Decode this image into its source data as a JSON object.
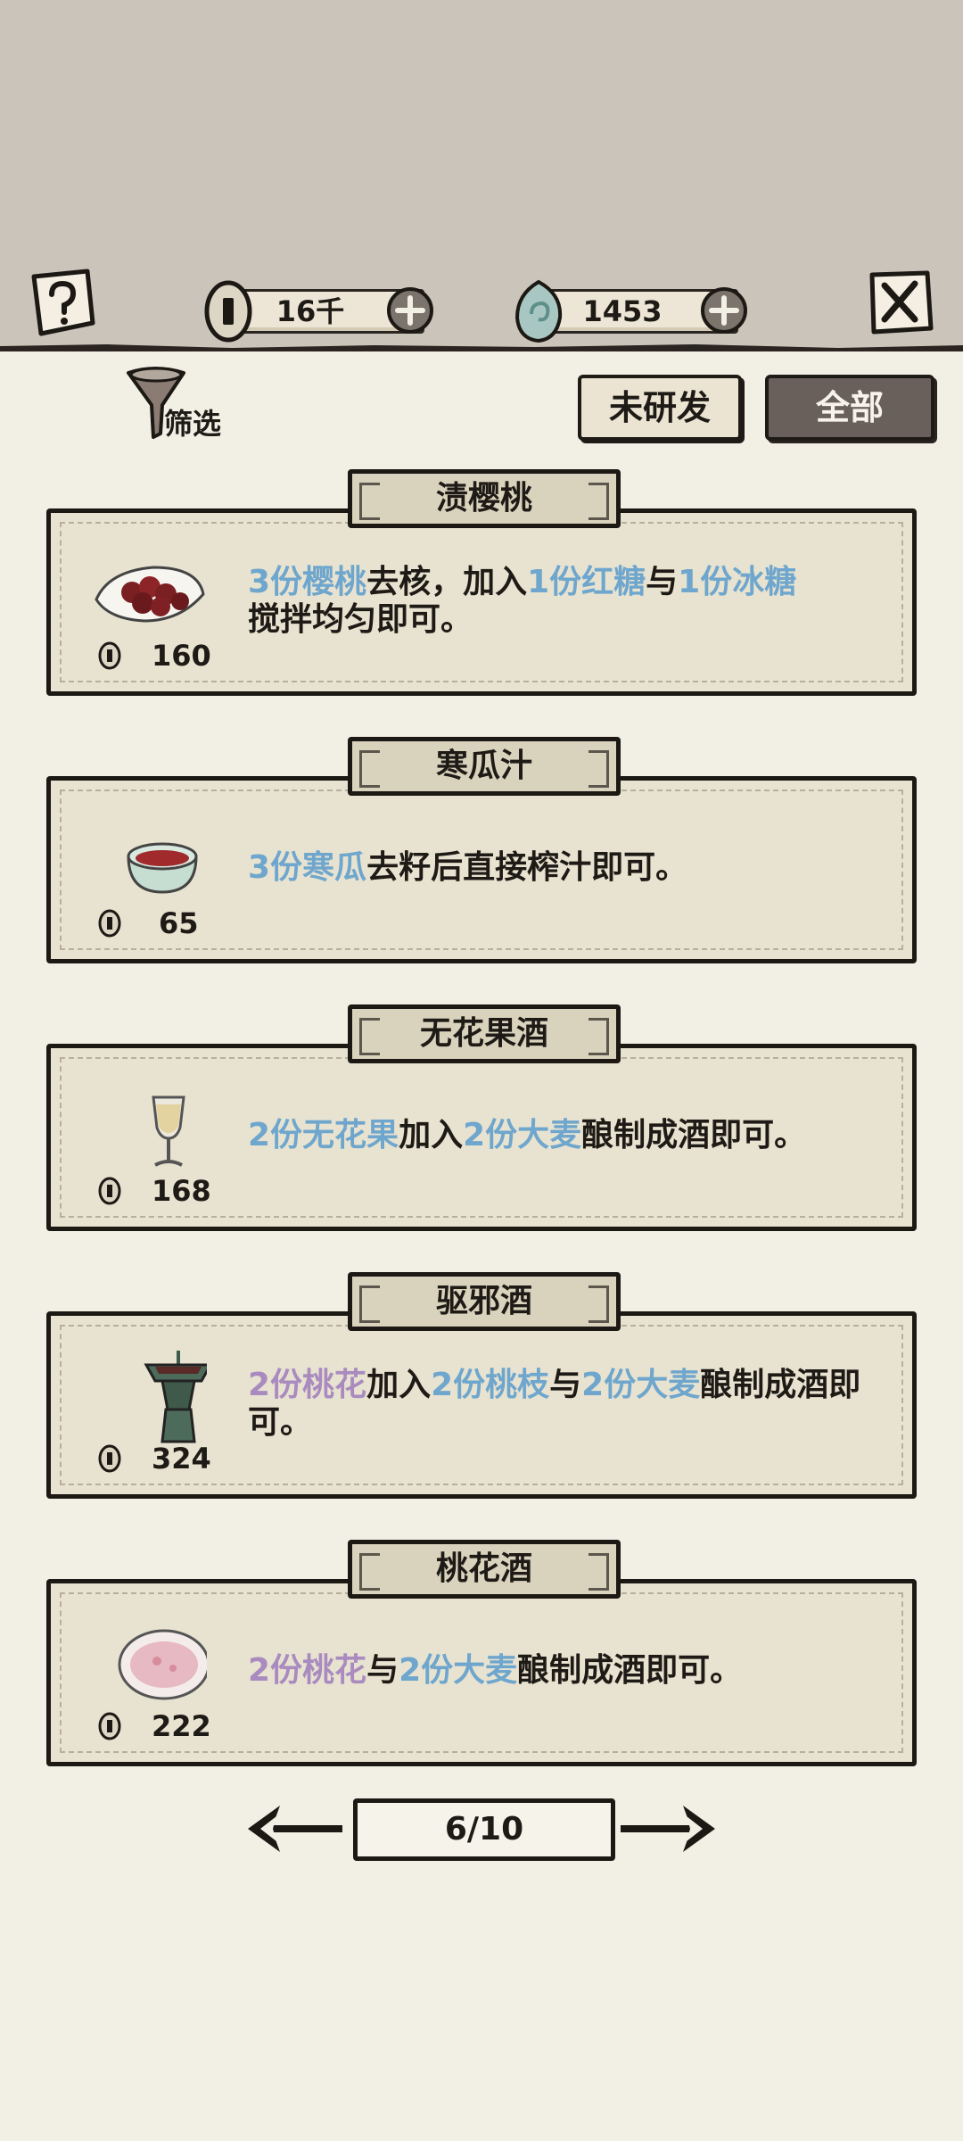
{
  "header": {
    "coins": "16千",
    "jade": "1453"
  },
  "filter": {
    "label": "筛选"
  },
  "tabs": {
    "undeveloped": "未研发",
    "all": "全部"
  },
  "recipes": [
    {
      "title": "渍樱桃",
      "cost": "160",
      "image": "cherry-plate-icon",
      "parts": [
        {
          "t": "3份樱桃",
          "c": "blue"
        },
        {
          "t": "去核，加入",
          "c": ""
        },
        {
          "t": "1份红糖",
          "c": "blue"
        },
        {
          "t": "与",
          "c": ""
        },
        {
          "t": "1份冰糖",
          "c": "blue"
        },
        {
          "t": "搅拌均匀即可。",
          "c": ""
        }
      ]
    },
    {
      "title": "寒瓜汁",
      "cost": "65",
      "image": "juice-bowl-icon",
      "parts": [
        {
          "t": "3份寒瓜",
          "c": "blue"
        },
        {
          "t": "去籽后直接榨汁即可。",
          "c": ""
        }
      ]
    },
    {
      "title": "无花果酒",
      "cost": "168",
      "image": "wine-glass-icon",
      "parts": [
        {
          "t": "2份无花果",
          "c": "blue"
        },
        {
          "t": "加入",
          "c": ""
        },
        {
          "t": "2份大麦",
          "c": "blue"
        },
        {
          "t": "酿制成酒即可。",
          "c": ""
        }
      ]
    },
    {
      "title": "驱邪酒",
      "cost": "324",
      "image": "bronze-vessel-icon",
      "parts": [
        {
          "t": "2份桃花",
          "c": "purple"
        },
        {
          "t": "加入",
          "c": ""
        },
        {
          "t": "2份桃枝",
          "c": "blue"
        },
        {
          "t": "与",
          "c": ""
        },
        {
          "t": "2份大麦",
          "c": "blue"
        },
        {
          "t": "酿制成酒即可。",
          "c": ""
        }
      ]
    },
    {
      "title": "桃花酒",
      "cost": "222",
      "image": "pink-bowl-icon",
      "parts": [
        {
          "t": "2份桃花",
          "c": "purple"
        },
        {
          "t": "与",
          "c": ""
        },
        {
          "t": "2份大麦",
          "c": "blue"
        },
        {
          "t": "酿制成酒即可。",
          "c": ""
        }
      ]
    }
  ],
  "pager": {
    "text": "6/10"
  },
  "colors": {
    "highlight_blue": "#6fa6cd",
    "highlight_purple": "#a98bbf",
    "background": "#f2efe4",
    "top_background": "#cbc4bb"
  }
}
